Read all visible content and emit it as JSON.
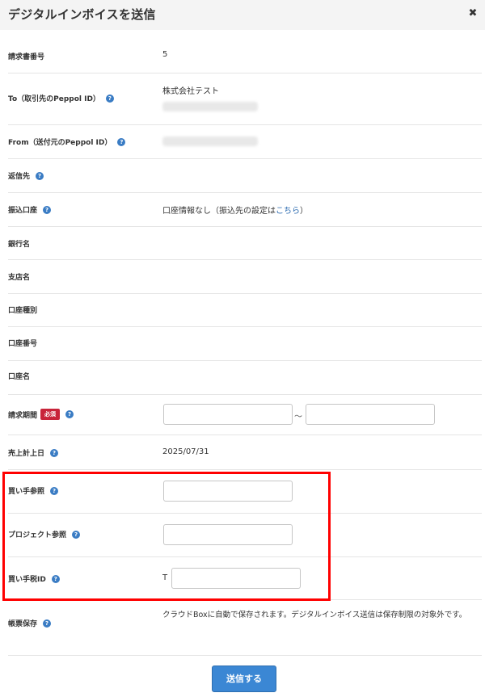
{
  "dialog": {
    "title": "デジタルインボイスを送信",
    "close_glyph": "✖"
  },
  "fields": {
    "invoice_number": {
      "label": "請求書番号",
      "value": "5"
    },
    "to": {
      "label": "To（取引先のPeppol ID）",
      "company": "株式会社テスト"
    },
    "from": {
      "label": "From（送付元のPeppol ID）"
    },
    "reply_to": {
      "label": "返信先"
    },
    "bank_account": {
      "label": "振込口座",
      "value_prefix": "口座情報なし（振込先の設定は",
      "link": "こちら",
      "value_suffix": "）"
    },
    "bank_name": {
      "label": "銀行名"
    },
    "branch_name": {
      "label": "支店名"
    },
    "account_type": {
      "label": "口座種別"
    },
    "account_number": {
      "label": "口座番号"
    },
    "account_holder": {
      "label": "口座名"
    },
    "billing_period": {
      "label": "請求期間",
      "required_badge": "必須",
      "separator": "〜",
      "start_value": "",
      "end_value": ""
    },
    "sales_date": {
      "label": "売上計上日",
      "value": "2025/07/31"
    },
    "buyer_reference": {
      "label": "買い手参照",
      "value": ""
    },
    "project_reference": {
      "label": "プロジェクト参照",
      "value": ""
    },
    "buyer_tax_id": {
      "label": "買い手税ID",
      "prefix": "T",
      "value": ""
    },
    "document_storage": {
      "label": "帳票保存",
      "value": "クラウドBoxに自動で保存されます。デジタルインボイス送信は保存制限の対象外です。"
    }
  },
  "help_glyph": "?",
  "submit_label": "送信する",
  "colors": {
    "accent": "#3b87d4",
    "required": "#c8243a",
    "help": "#3a7cc4",
    "highlight": "#ff0000",
    "link": "#2a6ab0"
  }
}
